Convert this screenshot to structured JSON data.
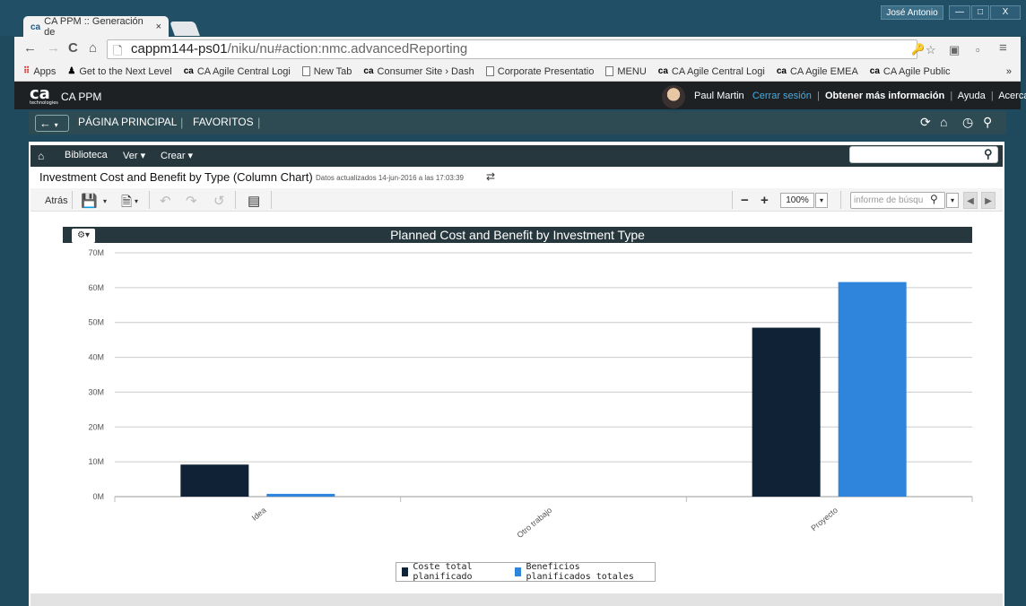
{
  "browser": {
    "tab_title": "CA PPM :: Generación de",
    "tab_close": "×",
    "user": "José Antonio",
    "win_min": "—",
    "win_max": "□",
    "win_close": "X",
    "url_host": "cappm144-ps01",
    "url_path": "/niku/nu#action:nmc.advancedReporting",
    "bookmarks": [
      {
        "icon": "apps-icon",
        "label": "Apps"
      },
      {
        "icon": "person-icon",
        "label": "Get to the Next Level"
      },
      {
        "icon": "ca-logo-icon",
        "label": "CA Agile Central Logi"
      },
      {
        "icon": "page-icon",
        "label": "New Tab"
      },
      {
        "icon": "ca-logo-icon",
        "label": "Consumer Site › Dash"
      },
      {
        "icon": "page-icon",
        "label": "Corporate Presentatio"
      },
      {
        "icon": "page-icon",
        "label": "MENU"
      },
      {
        "icon": "ca-logo-icon",
        "label": "CA Agile Central Logi"
      },
      {
        "icon": "ca-logo-icon",
        "label": "CA Agile EMEA"
      },
      {
        "icon": "ca-logo-icon",
        "label": "CA Agile Public"
      }
    ],
    "bookmarks_more": "»"
  },
  "app": {
    "logo": "ca",
    "logo_sub": "technologies",
    "name": "CA PPM",
    "user_name": "Paul Martin",
    "logout": "Cerrar sesión",
    "more_info": "Obtener más información",
    "help": "Ayuda",
    "about": "Acerca de"
  },
  "mainnav": {
    "home": "PÁGINA PRINCIPAL",
    "favorites": "FAVORITOS"
  },
  "subnav": {
    "library": "Biblioteca",
    "view": "Ver ▾",
    "create": "Crear ▾"
  },
  "report": {
    "title": "Investment Cost and Benefit by Type (Column Chart)",
    "updated": "Datos actualizados 14-jun-2016 a las 17:03:39",
    "back": "Atrás",
    "zoom": "100%",
    "search_placeholder": "informe de búsqu"
  },
  "colors": {
    "cost": "#0f2236",
    "benefit": "#2f84dc"
  },
  "chart_data": {
    "type": "bar",
    "title": "Planned Cost and Benefit by Investment Type",
    "categories": [
      "Idea",
      "Otro trabajo",
      "Proyecto"
    ],
    "series": [
      {
        "name": "Coste total planificado",
        "values": [
          9.2,
          0,
          48.5
        ]
      },
      {
        "name": "Beneficios planificados totales",
        "values": [
          0.8,
          0,
          61.6
        ]
      }
    ],
    "ylim": [
      0,
      70
    ],
    "yticks": [
      "0M",
      "10M",
      "20M",
      "30M",
      "40M",
      "50M",
      "60M",
      "70M"
    ],
    "grid": true,
    "legend": "bottom"
  }
}
